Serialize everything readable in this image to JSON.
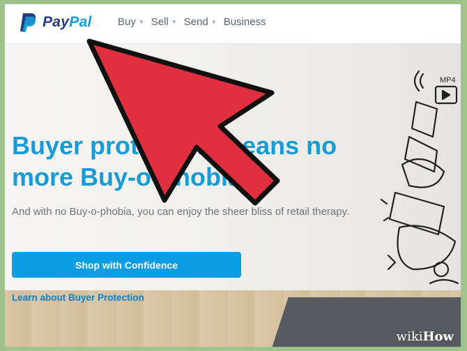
{
  "header": {
    "logo": {
      "pay": "Pay",
      "pal": "Pal"
    },
    "nav": [
      {
        "label": "Buy",
        "has_caret": true
      },
      {
        "label": "Sell",
        "has_caret": true
      },
      {
        "label": "Send",
        "has_caret": true
      },
      {
        "label": "Business",
        "has_caret": false
      }
    ]
  },
  "hero": {
    "title_line1": "Buyer protection means no",
    "title_line2": "more Buy-o-phobia",
    "subtitle": "And with no Buy-o-phobia, you can enjoy the sheer bliss of retail therapy.",
    "cta_label": "Shop with Confidence",
    "learn_link": "Learn about Buyer Protection"
  },
  "doodle": {
    "mp4_label": "MP4"
  },
  "watermark": {
    "wiki": "wiki",
    "how": "How"
  },
  "colors": {
    "paypal_dark": "#253b80",
    "paypal_light": "#179bd7",
    "cta": "#0b9de3",
    "arrow": "#e03040"
  },
  "icons": [
    "paypal-logo-icon",
    "caret-down-icon",
    "red-arrow-pointer-icon"
  ]
}
